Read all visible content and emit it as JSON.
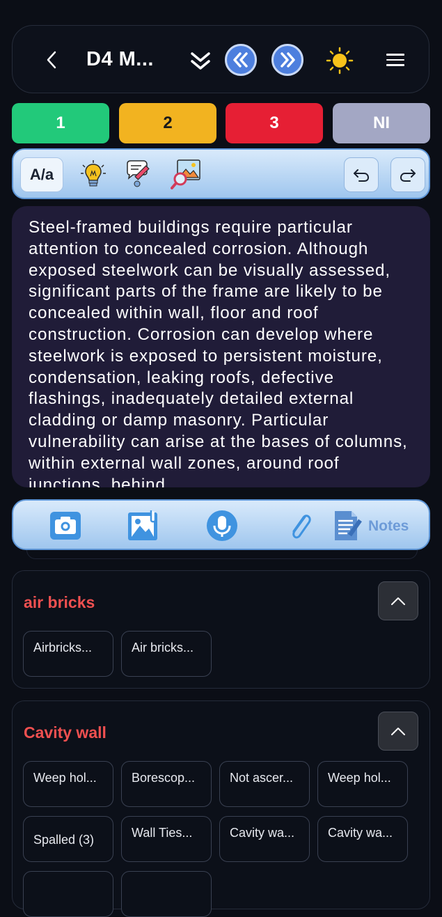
{
  "header": {
    "title": "D4 M...",
    "icons": [
      "back-icon",
      "chevron-double-down-icon",
      "rewind-icon",
      "fast-forward-icon",
      "sun-icon",
      "menu-icon"
    ]
  },
  "scores": [
    {
      "label": "1",
      "color": "#22c97a",
      "text_color": "#ffffff"
    },
    {
      "label": "2",
      "color": "#f2b320",
      "text_color": "#1a1a1a"
    },
    {
      "label": "3",
      "color": "#e61f34",
      "text_color": "#ffffff"
    },
    {
      "label": "NI",
      "color": "#a3a7c4",
      "text_color": "#ffffff"
    }
  ],
  "toolbar": {
    "font_toggle": "A/a",
    "icons": [
      "lightbulb-icon",
      "phrases-icon",
      "image-search-icon",
      "undo-icon",
      "redo-icon"
    ]
  },
  "body_text": "Steel-framed buildings require particular attention to concealed corrosion. Although exposed steelwork can be visually assessed, significant parts of the frame are likely to be concealed within wall, floor and roof construction. Corrosion can develop where steelwork is exposed to persistent moisture, condensation, leaking roofs, defective flashings, inadequately detailed external cladding or damp masonry. Particular vulnerability can arise at the bases of columns, within external wall zones, around roof junctions, behind",
  "media_bar": {
    "icons": [
      "camera-icon",
      "gallery-icon",
      "microphone-icon",
      "attachment-icon",
      "notes-icon"
    ],
    "notes_label": "Notes"
  },
  "sections": [
    {
      "title": "air bricks",
      "chips": [
        "Airbricks...",
        "Air bricks..."
      ]
    },
    {
      "title": "Cavity wall",
      "chips": [
        "Weep hol...",
        "Borescop...",
        "Not ascer...",
        "Weep hol...",
        "Spalled (3)",
        "Wall Ties...",
        "Cavity wa...",
        "Cavity wa..."
      ]
    }
  ]
}
